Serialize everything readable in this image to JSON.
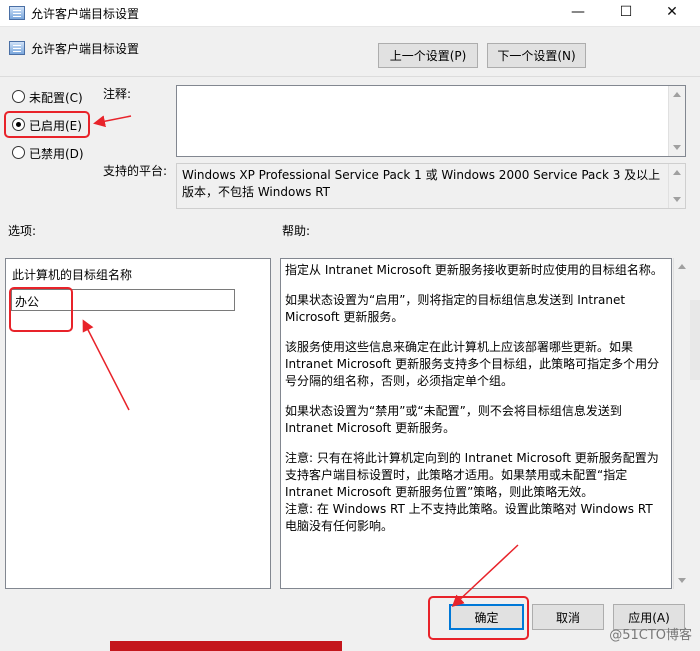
{
  "window": {
    "title": "允许客户端目标设置",
    "controls": {
      "minimize": "—",
      "maximize": "☐",
      "close": "✕"
    }
  },
  "header": {
    "policy_title": "允许客户端目标设置",
    "prev_button": "上一个设置(P)",
    "next_button": "下一个设置(N)"
  },
  "state": {
    "options": [
      {
        "label": "未配置(C)",
        "checked": false
      },
      {
        "label": "已启用(E)",
        "checked": true
      },
      {
        "label": "已禁用(D)",
        "checked": false
      }
    ]
  },
  "comment": {
    "label": "注释:",
    "value": ""
  },
  "platform": {
    "label": "支持的平台:",
    "value": "Windows XP Professional Service Pack 1 或 Windows 2000 Service Pack 3 及以上版本，不包括 Windows RT"
  },
  "options_panel": {
    "label": "选项:",
    "field_label": "此计算机的目标组名称",
    "field_value": "办公"
  },
  "help_panel": {
    "label": "帮助:",
    "paragraphs": [
      "指定从 Intranet Microsoft 更新服务接收更新时应使用的目标组名称。",
      "如果状态设置为“启用”，则将指定的目标组信息发送到 Intranet Microsoft 更新服务。",
      "该服务使用这些信息来确定在此计算机上应该部署哪些更新。如果 Intranet Microsoft 更新服务支持多个目标组，此策略可指定多个用分号分隔的组名称，否则，必须指定单个组。",
      "如果状态设置为“禁用”或“未配置”，则不会将目标组信息发送到 Intranet Microsoft 更新服务。",
      "注意: 只有在将此计算机定向到的 Intranet Microsoft 更新服务配置为支持客户端目标设置时，此策略才适用。如果禁用或未配置“指定 Intranet Microsoft 更新服务位置”策略，则此策略无效。",
      "注意: 在 Windows RT 上不支持此策略。设置此策略对 Windows RT 电脑没有任何影响。"
    ]
  },
  "footer": {
    "ok_button": "确定",
    "cancel_button": "取消",
    "apply_button": "应用(A)"
  },
  "watermark": "@51CTO博客",
  "colors": {
    "annotation": "#e8232a",
    "accent": "#0078d7"
  }
}
